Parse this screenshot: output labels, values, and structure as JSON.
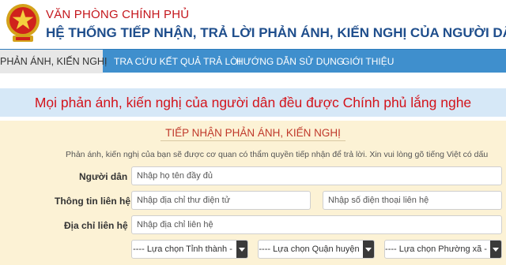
{
  "header": {
    "org": "VĂN PHÒNG CHÍNH PHỦ",
    "system": "HỆ THỐNG TIẾP NHẬN, TRẢ LỜI PHẢN ÁNH, KIẾN NGHỊ CỦA NGƯỜI DÂN",
    "emblem_icon": "national-emblem-icon"
  },
  "nav": {
    "items": [
      {
        "label": "PHẢN ÁNH, KIẾN NGHỊ",
        "active": true
      },
      {
        "label": "TRA CỨU KẾT QUẢ TRẢ LỜI",
        "active": false
      },
      {
        "label": "HƯỚNG DẪN SỬ DỤNG",
        "active": false
      },
      {
        "label": "GIỚI THIỆU",
        "active": false
      }
    ]
  },
  "banner": {
    "text": "Mọi phản ánh, kiến nghị của người dân đều được Chính phủ lắng nghe"
  },
  "form": {
    "title": "TIẾP NHẬN PHẢN ÁNH, KIẾN NGHỊ",
    "hint": "Phản ánh, kiến nghị của bạn sẽ được cơ quan có thẩm quyền tiếp nhận để trả lời. Xin vui lòng gõ tiếng Việt có dấu",
    "name": {
      "label": "Người dân",
      "placeholder": "Nhập họ tên đầy đủ"
    },
    "contact": {
      "label": "Thông tin liên hệ",
      "email_placeholder": "Nhập địa chỉ thư điện tử",
      "phone_placeholder": "Nhập số điện thoại liên hệ"
    },
    "address": {
      "label": "Địa chỉ liên hệ",
      "placeholder": "Nhập địa chỉ liên hệ",
      "province": "---- Lựa chọn Tỉnh thành -",
      "district": "---- Lựa chọn Quận huyện",
      "ward": "---- Lựa chọn Phường xã -"
    }
  },
  "colors": {
    "nav_bg": "#3f8fcd",
    "banner_bg": "#d6e8f7",
    "banner_text": "#d3141c",
    "panel_bg": "#fcf2d5",
    "title_blue": "#1f4e8c",
    "org_red": "#c4161c"
  }
}
